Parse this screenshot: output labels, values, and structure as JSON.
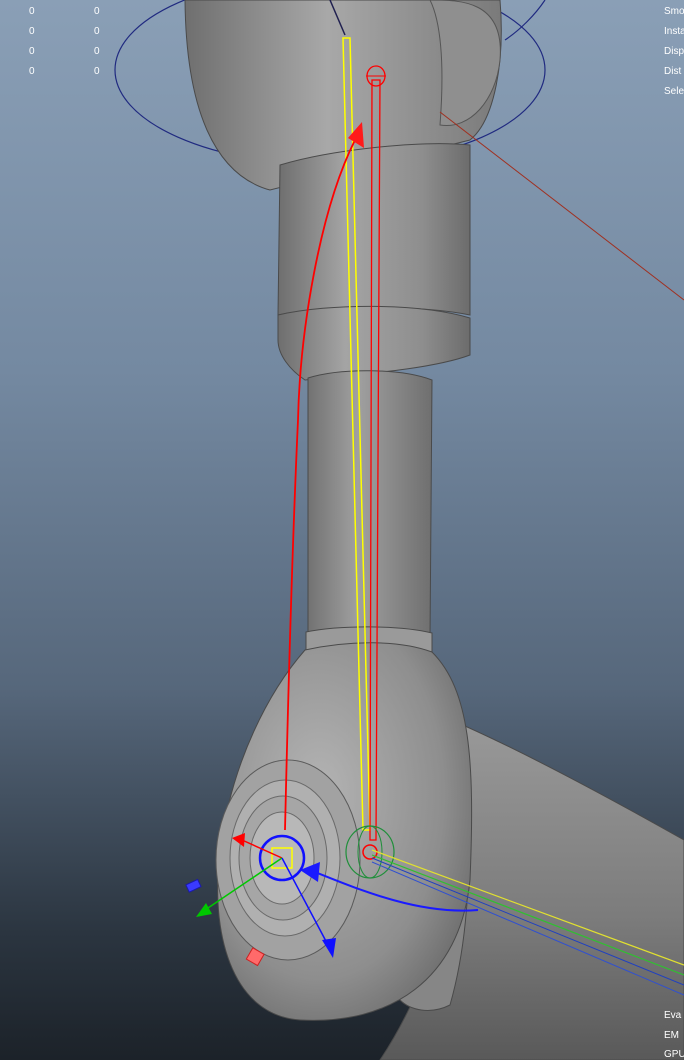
{
  "hud": {
    "rows": [
      {
        "a": "0",
        "b": "0"
      },
      {
        "a": "0",
        "b": "0"
      },
      {
        "a": "0",
        "b": "0"
      },
      {
        "a": "0",
        "b": "0"
      }
    ],
    "right_top_labels": [
      "Smo",
      "Insta",
      "Disp",
      "Dist",
      "Sele"
    ],
    "right_bottom_labels": [
      "Eva",
      "EM",
      "GPU"
    ]
  },
  "colors": {
    "background_top": "#8a9fb6",
    "background_bottom": "#1c2229",
    "mesh": "#9a9a9a",
    "ik_handle": "#ff0000",
    "selection": "#ffff00",
    "move_y_axis": "#00c800",
    "move_z_axis": "#0000ff",
    "move_x_axis": "#ff0000",
    "wire_blue": "#1a1aff"
  }
}
